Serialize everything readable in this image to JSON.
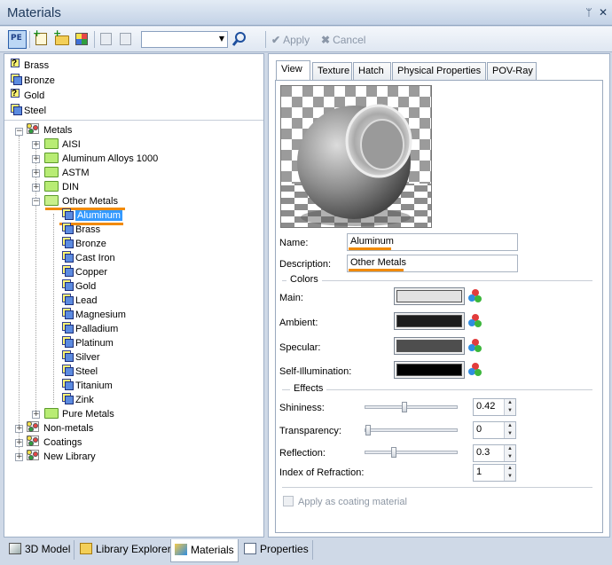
{
  "window": {
    "title": "Materials",
    "pin_glyph": "ᛘ",
    "close_glyph": "✕"
  },
  "toolbar": {
    "search_placeholder": "",
    "apply_label": "Apply",
    "cancel_label": "Cancel"
  },
  "top_list": [
    "Brass",
    "Bronze",
    "Gold",
    "Steel"
  ],
  "tree": {
    "root": "Metals",
    "folders": [
      "AISI",
      "Aluminum Alloys 1000",
      "ASTM",
      "DIN",
      "Other Metals"
    ],
    "other_metals_items": [
      "Aluminum",
      "Brass",
      "Bronze",
      "Cast Iron",
      "Copper",
      "Gold",
      "Lead",
      "Magnesium",
      "Palladium",
      "Platinum",
      "Silver",
      "Steel",
      "Titanium",
      "Zink"
    ],
    "selected": "Aluminum",
    "pure_metals": "Pure Metals",
    "libraries": [
      "Non-metals",
      "Coatings",
      "New Library"
    ]
  },
  "tabs": [
    "View",
    "Texture",
    "Hatch",
    "Physical Properties",
    "POV-Ray"
  ],
  "props": {
    "name_label": "Name:",
    "name_value": "Aluminum",
    "desc_label": "Description:",
    "desc_value": "Other Metals",
    "colors_title": "Colors",
    "colors": [
      {
        "label": "Main:",
        "hex": "#e2e2e2"
      },
      {
        "label": "Ambient:",
        "hex": "#1c1c1c"
      },
      {
        "label": "Specular:",
        "hex": "#4e4e4e"
      },
      {
        "label": "Self-Illumination:",
        "hex": "#000000"
      }
    ],
    "effects_title": "Effects",
    "effects": [
      {
        "label": "Shininess:",
        "value": "0.42",
        "level": 0.42
      },
      {
        "label": "Transparency:",
        "value": "0",
        "level": 0
      },
      {
        "label": "Reflection:",
        "value": "0.3",
        "level": 0.3
      }
    ],
    "ior_label": "Index of Refraction:",
    "ior_value": "1",
    "coating_label": "Apply as coating material"
  },
  "bottom_tabs": [
    "3D Model",
    "Library Explorer",
    "Materials",
    "Properties"
  ],
  "active_bottom_tab": "Materials",
  "colors": {
    "accent": "#3399ff",
    "highlight_underline": "#f18a00"
  }
}
